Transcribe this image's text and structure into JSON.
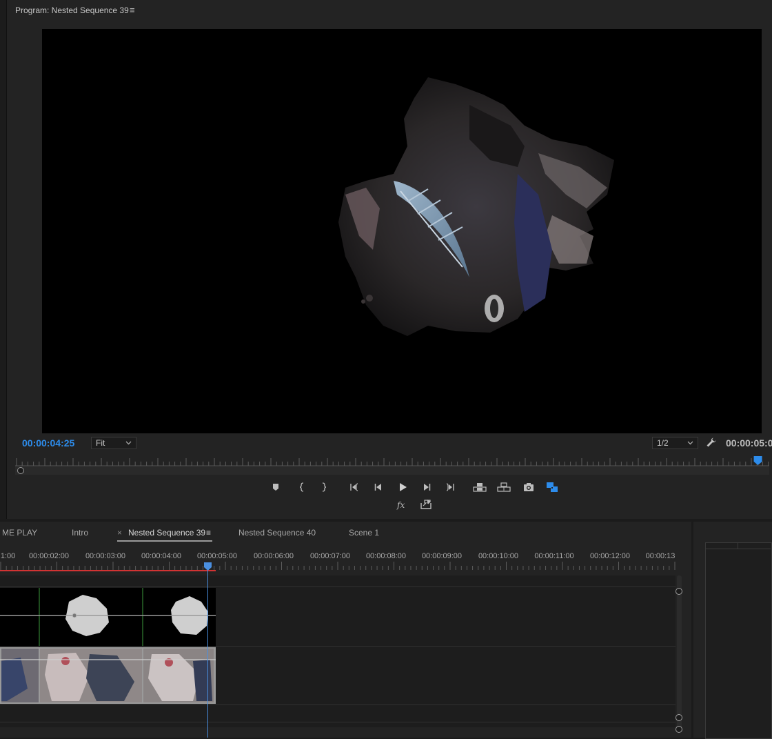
{
  "program_monitor": {
    "title": "Program: Nested Sequence 39",
    "menu_glyph": "≡",
    "current_timecode": "00:00:04:25",
    "zoom_select": "Fit",
    "resolution_select": "1/2",
    "duration_timecode": "00:00:05:0",
    "playhead_position_fraction": 0.985,
    "accent_color": "#2d8ceb"
  },
  "transport_icons": [
    "add-marker-icon",
    "mark-in-icon",
    "mark-out-icon",
    "go-to-in-icon",
    "step-back-icon",
    "play-icon",
    "step-forward-icon",
    "go-to-out-icon",
    "lift-icon",
    "extract-icon",
    "export-frame-icon",
    "comparison-view-icon"
  ],
  "transport_row2_icons": [
    "fx-icon",
    "export-icon"
  ],
  "timeline": {
    "tabs": [
      {
        "label": "ME PLAY"
      },
      {
        "label": "Intro"
      },
      {
        "label": "Nested Sequence 39",
        "close": "×",
        "menu": "≡",
        "active": true
      },
      {
        "label": "Nested Sequence 40"
      },
      {
        "label": "Scene 1"
      }
    ],
    "ruler_labels": [
      ":1:00",
      "00:00:02:00",
      "00:00:03:00",
      "00:00:04:00",
      "00:00:05:00",
      "00:00:06:00",
      "00:00:07:00",
      "00:00:08:00",
      "00:00:09:00",
      "00:00:10:00",
      "00:00:11:00",
      "00:00:12:00",
      "00:00:13"
    ],
    "work_area_color": "#d23333",
    "playhead_color": "#4a8fe0"
  }
}
